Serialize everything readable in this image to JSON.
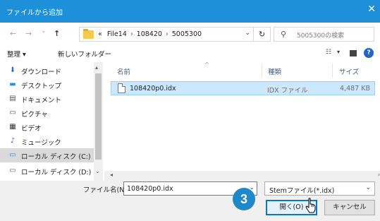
{
  "window": {
    "title": "ファイルから追加",
    "close_glyph": "✕"
  },
  "nav": {
    "back_glyph": "←",
    "forward_glyph": "→",
    "recent_glyph": "⌄",
    "up_glyph": "↑",
    "breadcrumb": [
      "«",
      "File14",
      "108420",
      "5005300"
    ],
    "breadcrumb_sep": "›",
    "dropdown_glyph": "⌄",
    "refresh_glyph": "↻",
    "search_placeholder": "5005300の検索",
    "search_glyph": "⚲"
  },
  "toolbar": {
    "organize_label": "整理 ▾",
    "new_folder_label": "新しいフォルダー",
    "view_glyph": "☷",
    "view_dd_glyph": "▾",
    "help_glyph": "?"
  },
  "sidebar": {
    "items": [
      {
        "label": "ダウンロード",
        "icon": "download-icon",
        "glyph": "⬇",
        "color": "#1f6fd1"
      },
      {
        "label": "デスクトップ",
        "icon": "desktop-icon",
        "glyph": "▬",
        "color": "#2a8de0"
      },
      {
        "label": "ドキュメント",
        "icon": "document-icon",
        "glyph": "▤",
        "color": "#555555"
      },
      {
        "label": "ピクチャ",
        "icon": "pictures-icon",
        "glyph": "▭",
        "color": "#555555"
      },
      {
        "label": "ビデオ",
        "icon": "video-icon",
        "glyph": "▦",
        "color": "#333333"
      },
      {
        "label": "ミュージック",
        "icon": "music-icon",
        "glyph": "♪",
        "color": "#1f6fd1"
      },
      {
        "label": "ローカル ディスク (C:)",
        "icon": "drive-c-icon",
        "glyph": "▭",
        "color": "#3a7bd5",
        "selected": true
      },
      {
        "label": "ローカル ディスク (D:)",
        "icon": "drive-d-icon",
        "glyph": "▭",
        "color": "#666666"
      }
    ],
    "expand_glyph": "⌄"
  },
  "list": {
    "columns": {
      "name": "名前",
      "type": "種類",
      "size": "サイズ"
    },
    "sort_glyph": "^",
    "rows": [
      {
        "name": "108420p0.idx",
        "type": "IDX ファイル",
        "size": "4,487 KB"
      }
    ]
  },
  "scroll": {
    "up": "▴",
    "down": "▾",
    "left": "◂",
    "right": "›"
  },
  "footer": {
    "filename_label": "ファイル名(N):",
    "filename_value": "108420p0.idx",
    "filter_value": "Stemファイル(*.idx)",
    "dd_glyph": "⌄",
    "open_label": "開く(O)",
    "cancel_label": "キャンセル"
  },
  "annotation": {
    "step_number": "3"
  },
  "colors": {
    "titlebar": "#1e8fd9",
    "selection": "#cce8ff",
    "accent": "#0078d7",
    "badge": "#1e88c8"
  }
}
